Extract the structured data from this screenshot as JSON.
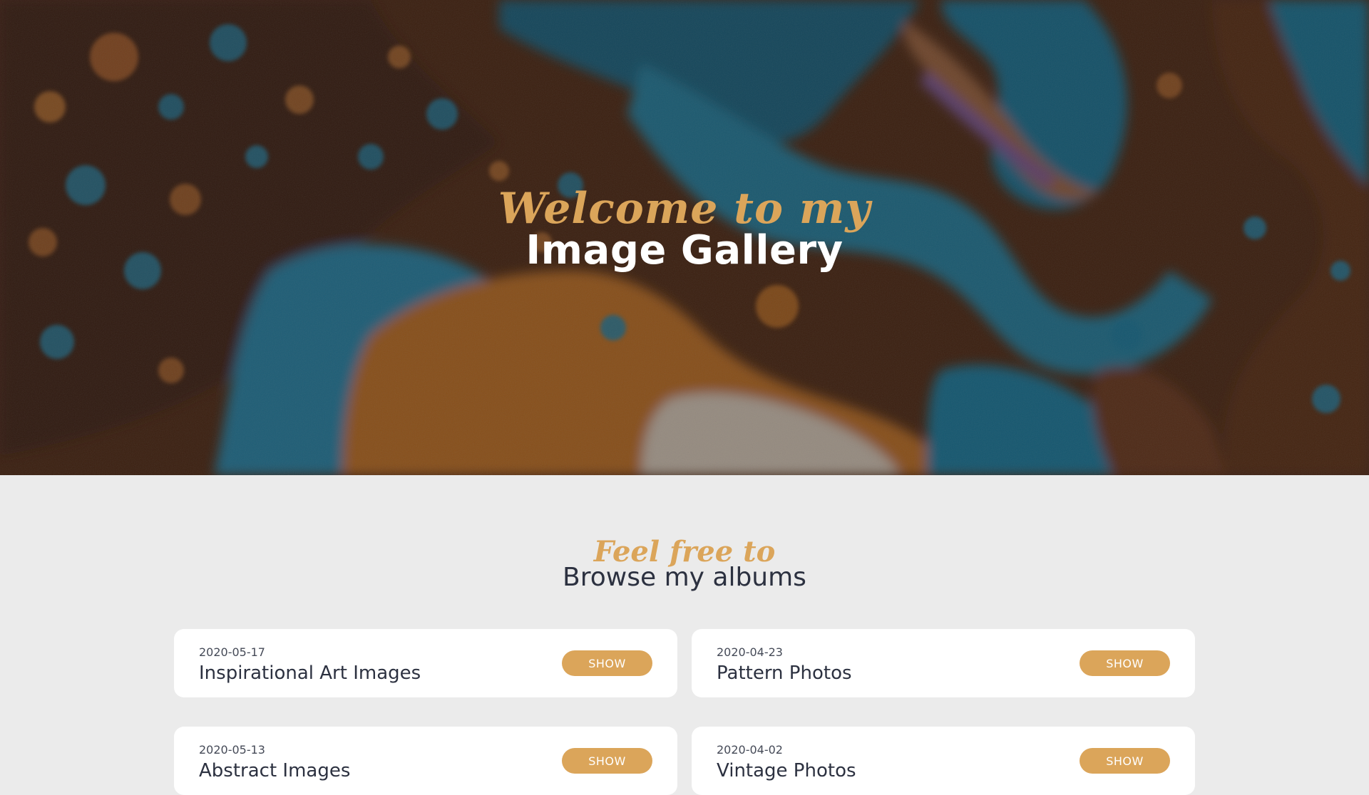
{
  "colors": {
    "accent": "#dba55a",
    "page_background": "#ebebeb",
    "card_background": "#ffffff",
    "heading_dark": "#2c3140",
    "hero_title": "#ffffff"
  },
  "hero": {
    "script_text": "Welcome to my",
    "title": "Image Gallery"
  },
  "browse": {
    "script_text": "Feel free to",
    "title": "Browse my albums"
  },
  "albums": [
    {
      "date": "2020-05-17",
      "title": "Inspirational Art Images",
      "button_label": "SHOW"
    },
    {
      "date": "2020-04-23",
      "title": "Pattern Photos",
      "button_label": "SHOW"
    },
    {
      "date": "2020-05-13",
      "title": "Abstract Images",
      "button_label": "SHOW"
    },
    {
      "date": "2020-04-02",
      "title": "Vintage Photos",
      "button_label": "SHOW"
    }
  ]
}
